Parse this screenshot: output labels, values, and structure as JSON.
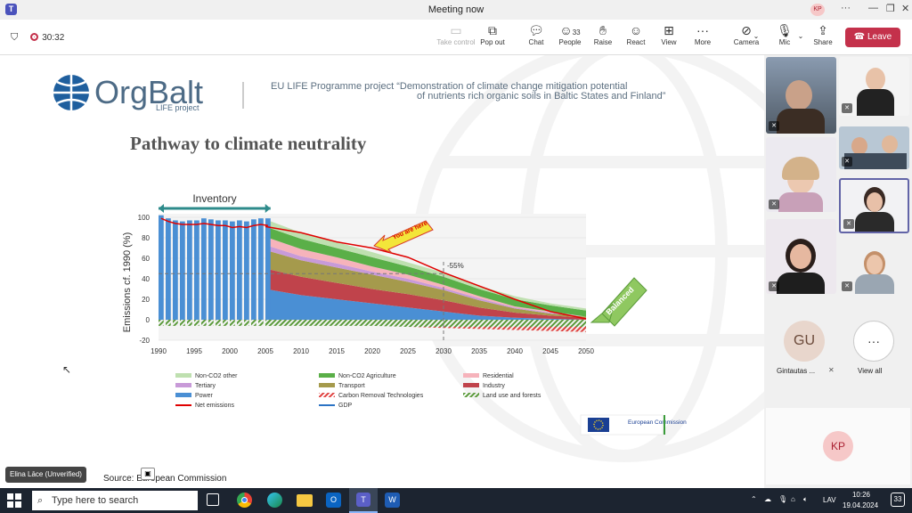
{
  "window": {
    "title": "Meeting now",
    "user_initials": "KP"
  },
  "toolbar": {
    "timer": "30:32",
    "take_control": "Take control",
    "pop_out": "Pop out",
    "chat": "Chat",
    "people": "People",
    "people_count": "33",
    "raise": "Raise",
    "react": "React",
    "view": "View",
    "more": "More",
    "camera": "Camera",
    "mic": "Mic",
    "share": "Share",
    "leave": "Leave"
  },
  "slide": {
    "logo": "OrgBalt",
    "logo_sub": "LIFE project",
    "header_line1": "EU LIFE Programme project “Demonstration of climate change mitigation potential",
    "header_line2": "of nutrients rich organic soils in Baltic States and Finland”",
    "title": "Pathway to climate neutrality",
    "inventory_label": "Inventory",
    "you_are_here": "You are here",
    "balanced": "Balanced",
    "pct_label": "-55%",
    "source": "Source: European Commission",
    "ec_logo": "European Commission",
    "presenter": "Elina Lāce (Unverified)"
  },
  "chart_data": {
    "type": "area",
    "ylabel": "Emissions cf. 1990 (%)",
    "xlabel": "",
    "x_ticks": [
      "1990",
      "1995",
      "2000",
      "2005",
      "2010",
      "2015",
      "2020",
      "2025",
      "2030",
      "2035",
      "2040",
      "2045",
      "2050"
    ],
    "y_ticks": [
      "100",
      "80",
      "60",
      "40",
      "20",
      "0",
      "-20"
    ],
    "ylim": [
      -20,
      100
    ],
    "xlim": [
      1990,
      2050
    ],
    "legend": [
      {
        "label": "Non-CO2 other",
        "color": "#bfe0b0",
        "kind": "box"
      },
      {
        "label": "Non-CO2 Agriculture",
        "color": "#5aaf48",
        "kind": "box"
      },
      {
        "label": "Residential",
        "color": "#f6b3bb",
        "kind": "box"
      },
      {
        "label": "Tertiary",
        "color": "#c89ad8",
        "kind": "box"
      },
      {
        "label": "Transport",
        "color": "#a59a4c",
        "kind": "box"
      },
      {
        "label": "Industry",
        "color": "#c0434b",
        "kind": "box"
      },
      {
        "label": "Power",
        "color": "#4a8fd4",
        "kind": "box"
      },
      {
        "label": "Carbon Removal Technologies",
        "color": "#e0413f",
        "kind": "hatch"
      },
      {
        "label": "Land use and forests",
        "color": "#5a9a3a",
        "kind": "hatch"
      },
      {
        "label": "Net emissions",
        "color": "#e00000",
        "kind": "line"
      },
      {
        "label": "GDP",
        "color": "#2b73c4",
        "kind": "line"
      }
    ],
    "inventory_bars": {
      "x": [
        1990,
        1991,
        1992,
        1993,
        1994,
        1995,
        1996,
        1997,
        1998,
        1999,
        2000,
        2001,
        2002,
        2003,
        2004,
        2005
      ],
      "gross": [
        102,
        99,
        97,
        96,
        97,
        97,
        99,
        98,
        97,
        97,
        96,
        97,
        96,
        98,
        99,
        99
      ],
      "net": [
        99,
        96,
        94,
        93,
        93,
        93,
        94,
        93,
        92,
        92,
        90,
        91,
        90,
        92,
        93,
        92
      ]
    },
    "projection": {
      "x": [
        2005,
        2010,
        2015,
        2020,
        2025,
        2030,
        2035,
        2040,
        2045,
        2050
      ],
      "series": [
        {
          "name": "Power",
          "values": [
            30,
            24,
            20,
            16,
            12,
            8,
            4,
            2,
            1,
            0
          ]
        },
        {
          "name": "Industry",
          "values": [
            20,
            18,
            16,
            14,
            13,
            11,
            8,
            5,
            3,
            2
          ]
        },
        {
          "name": "Transport",
          "values": [
            18,
            16,
            15,
            14,
            12,
            10,
            7,
            4,
            2,
            1
          ]
        },
        {
          "name": "Tertiary",
          "values": [
            5,
            4,
            4,
            3,
            3,
            2,
            2,
            1,
            1,
            0
          ]
        },
        {
          "name": "Residential",
          "values": [
            8,
            7,
            6,
            5,
            4,
            3,
            2,
            1,
            1,
            0
          ]
        },
        {
          "name": "Non-CO2 Agriculture",
          "values": [
            10,
            10,
            9,
            9,
            8,
            8,
            7,
            7,
            6,
            6
          ]
        },
        {
          "name": "Non-CO2 other",
          "values": [
            7,
            6,
            6,
            5,
            4,
            4,
            3,
            3,
            2,
            2
          ]
        }
      ],
      "net": [
        91,
        85,
        76,
        70,
        61,
        46,
        33,
        20,
        8,
        1
      ],
      "land_use": [
        -6,
        -6,
        -6,
        -6,
        -7,
        -7,
        -7,
        -7,
        -7,
        -7
      ],
      "removal": [
        0,
        0,
        0,
        0,
        0,
        -1,
        -2,
        -3,
        -4,
        -5
      ]
    }
  },
  "participants": {
    "gu_initials": "GU",
    "gu_name": "Gintautas ...",
    "view_all": "View all",
    "kp_initials": "KP"
  },
  "taskbar": {
    "search_placeholder": "Type here to search",
    "lang": "LAV",
    "time": "10:26",
    "date": "19.04.2024",
    "notif": "33"
  }
}
